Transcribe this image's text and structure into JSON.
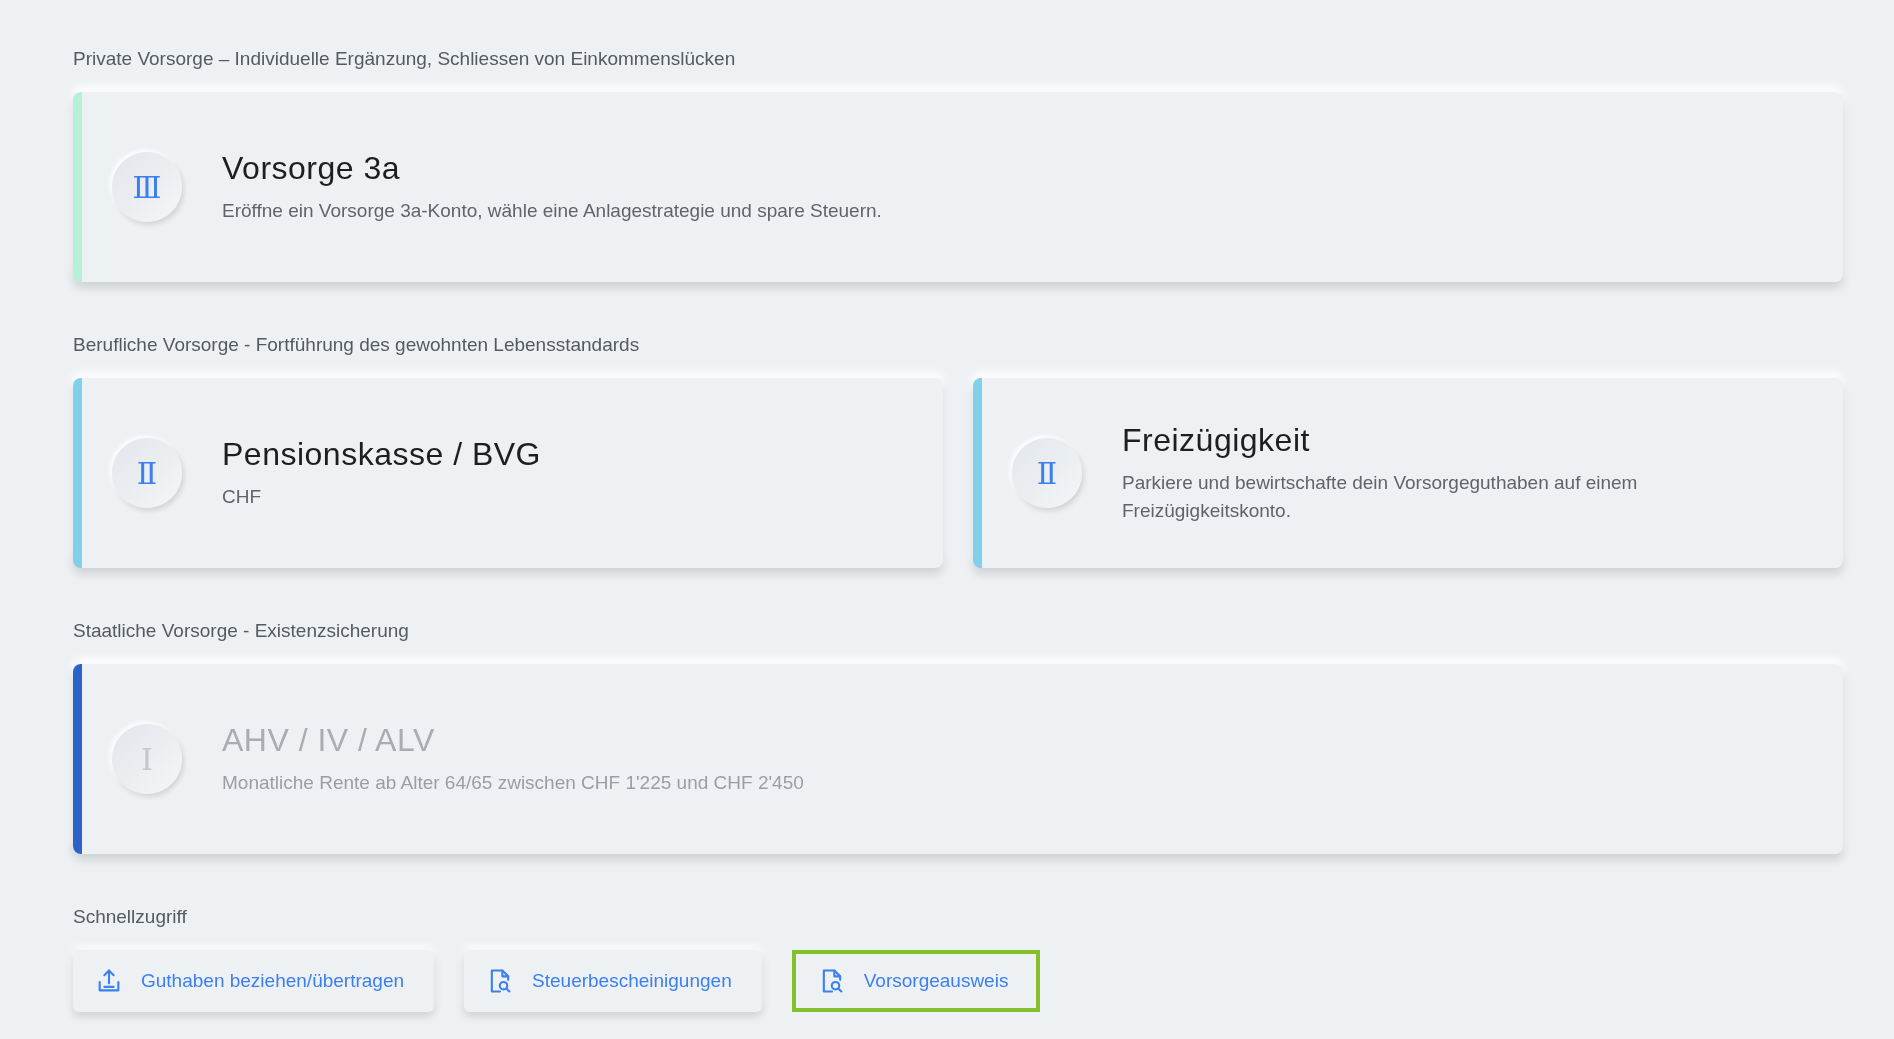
{
  "sections": [
    {
      "title": "Private Vorsorge – Individuelle Ergänzung, Schliessen von Einkommenslücken",
      "cards": [
        {
          "numeral": "Ⅲ",
          "title": "Vorsorge 3a",
          "description": "Eröffne ein Vorsorge 3a-Konto, wähle eine Anlagestrategie und spare Steuern.",
          "color": "#b6f0d6",
          "disabled": false
        }
      ]
    },
    {
      "title": "Berufliche Vorsorge - Fortführung des gewohnten Lebensstandards",
      "cards": [
        {
          "numeral": "Ⅱ",
          "title": "Pensionskasse / BVG",
          "description": "CHF",
          "color": "#7fd0e8",
          "disabled": false
        },
        {
          "numeral": "Ⅱ",
          "title": "Freizügigkeit",
          "description": "Parkiere und bewirtschafte dein Vorsorgeguthaben auf einem Freizügigkeitskonto.",
          "color": "#7fd0e8",
          "disabled": false
        }
      ]
    },
    {
      "title": "Staatliche Vorsorge - Existenzsicherung",
      "cards": [
        {
          "numeral": "Ⅰ",
          "title": "AHV / IV / ALV",
          "description": "Monatliche Rente ab Alter 64/65 zwischen CHF 1'225 und CHF 2'450",
          "color": "#2b63c9",
          "disabled": true
        }
      ]
    }
  ],
  "quick_access": {
    "title": "Schnellzugriff",
    "buttons": [
      {
        "label": "Guthaben beziehen/übertragen",
        "kind": "upload",
        "focused": false
      },
      {
        "label": "Steuerbescheinigungen",
        "kind": "document-search",
        "focused": false
      },
      {
        "label": "Vorsorgeausweis",
        "kind": "document-search",
        "focused": true
      }
    ]
  }
}
